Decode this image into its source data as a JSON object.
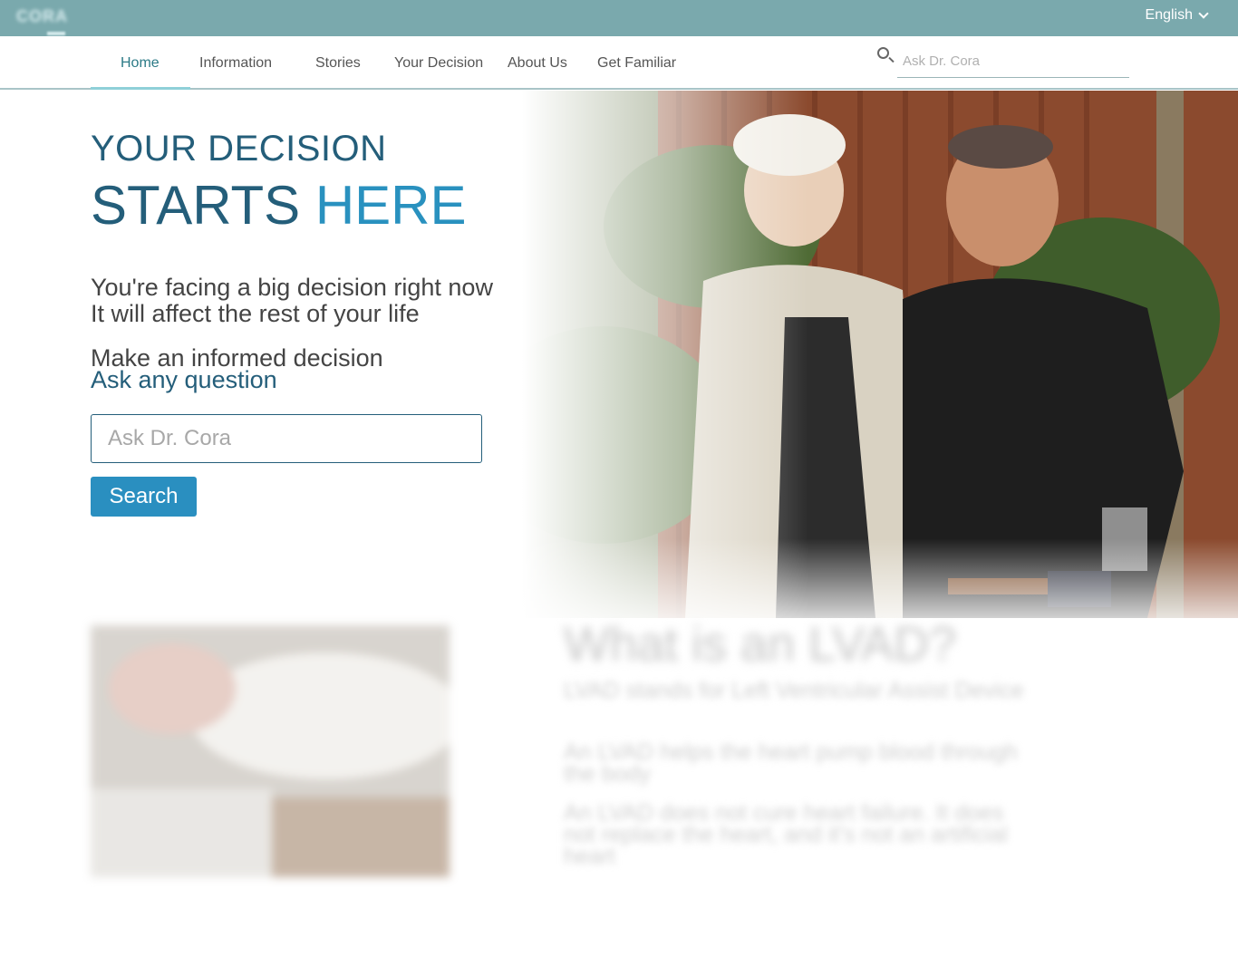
{
  "topbar": {
    "logo": "CORA",
    "language": "English",
    "chevron_icon": "chevron-down-icon"
  },
  "nav": {
    "items": [
      {
        "label": "Home",
        "active": true
      },
      {
        "label": "Information"
      },
      {
        "label": "Stories"
      },
      {
        "label": "Your Decision"
      },
      {
        "label": "About Us"
      },
      {
        "label": "Get Familiar"
      }
    ],
    "search_icon": "search-icon",
    "search_placeholder": "Ask Dr. Cora"
  },
  "hero": {
    "title_line1": "YOUR DECISION",
    "title_line2_main": "STARTS",
    "title_line2_accent": "HERE",
    "line1": "You're facing a big decision right now",
    "line2": "It will affect the rest of your life",
    "line3": "Make an informed decision",
    "link": "Ask any question",
    "input_placeholder": "Ask Dr. Cora",
    "button": "Search"
  },
  "lvad": {
    "title": "What is an LVAD?",
    "paragraphs": [
      "LVAD stands for Left Ventricular Assist Device",
      "An LVAD helps the heart pump blood through the body",
      "An LVAD does not cure heart failure. It does not replace the heart, and it's not an artificial heart"
    ]
  },
  "colors": {
    "topbar": "#7aa9ad",
    "title": "#245e7a",
    "accent": "#2991bf",
    "button": "#2a8fc0"
  }
}
